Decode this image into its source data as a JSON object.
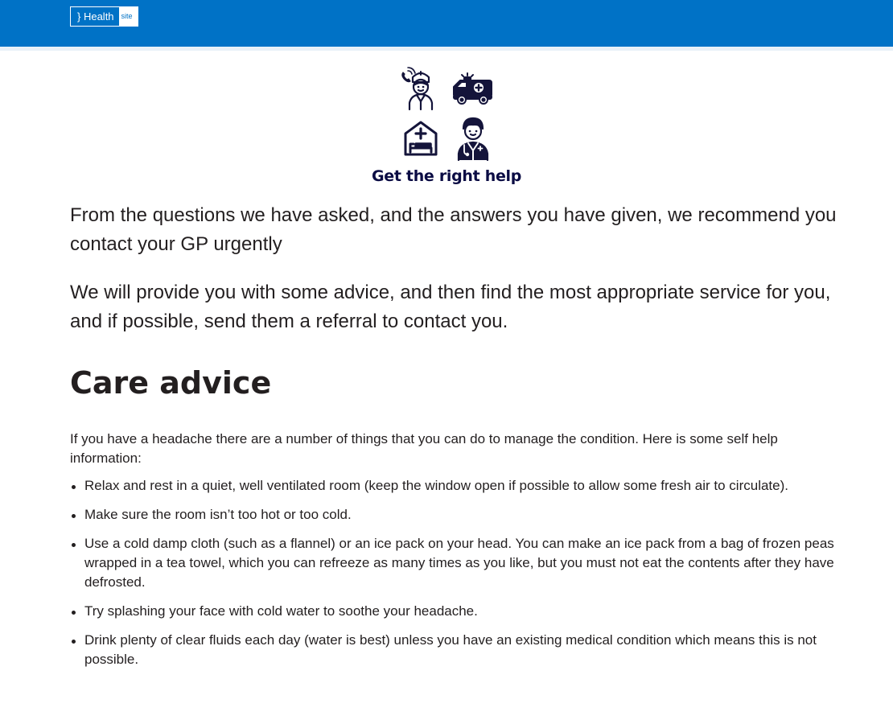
{
  "header": {
    "logo_text": "} Health",
    "logo_tag": "site",
    "brand_color": "#0072c6"
  },
  "hero": {
    "icons": [
      "nurse-phone-icon",
      "ambulance-icon",
      "hospital-bed-icon",
      "doctor-icon"
    ],
    "title": "Get the right help"
  },
  "recommendation": {
    "text_1": "From the questions we have asked, and the answers you have given, we recommend you contact your GP urgently",
    "text_2": "We will provide you with some advice, and then find the most appropriate service for you, and if possible, send them a referral to contact you."
  },
  "care_advice": {
    "heading": "Care advice",
    "intro": "If you have a headache there are a number of things that you can do to manage the condition. Here is some self help information:",
    "items": [
      "Relax and rest in a quiet, well ventilated room (keep the window open if possible to allow some fresh air to circulate).",
      "Make sure the room isn’t too hot or too cold.",
      "Use a cold damp cloth (such as a flannel) or an ice pack on your head. You can make an ice pack from a bag of frozen peas wrapped in a tea towel, which you can refreeze as many times as you like, but you must not eat the contents after they have defrosted.",
      "Try splashing your face with cold water to soothe your headache.",
      "Drink plenty of clear fluids each day (water is best) unless you have an existing medical condition which means this is not possible."
    ]
  }
}
